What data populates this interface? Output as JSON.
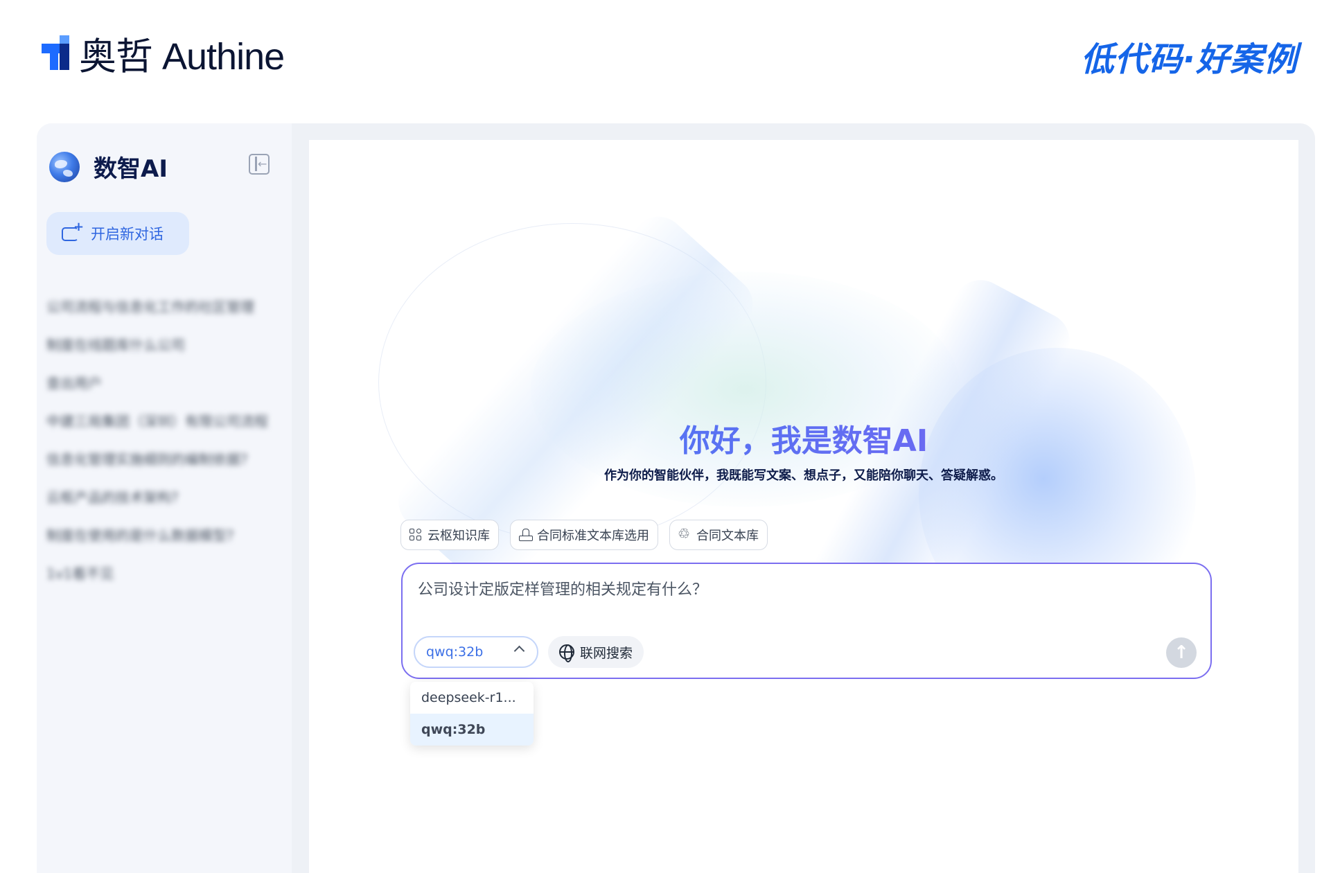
{
  "header": {
    "brand_name": "奥哲 Authine",
    "slogan": "低代码·好案例"
  },
  "sidebar": {
    "title": "数智AI",
    "new_chat_label": "开启新对话",
    "history": [
      "公司流程与信息化工作的社区管理",
      "制度在线题库什么公司",
      "查出用户",
      "中建三局集团（深圳）有限公司流程",
      "信息化管理实施细则的编制依据?",
      "云枢产品的技术架构?",
      "制度在使用的是什么数据模型?",
      "1v1看不见"
    ]
  },
  "main": {
    "greeting": "你好，我是数智AI",
    "subtitle": "作为你的智能伙伴，我既能写文案、想点子，又能陪你聊天、答疑解惑。",
    "chips": [
      {
        "label": "云枢知识库",
        "icon": "grid-icon"
      },
      {
        "label": "合同标准文本库选用",
        "icon": "stamp-icon"
      },
      {
        "label": "合同文本库",
        "icon": "recycle-icon"
      }
    ],
    "input": {
      "value": "公司设计定版定样管理的相关规定有什么？",
      "placeholder": ""
    },
    "model": {
      "selected": "qwq:32b",
      "options": [
        "deepseek-r1...",
        "qwq:32b"
      ]
    },
    "web_search_label": "联网搜索",
    "colors": {
      "accent": "#2f66e0",
      "input_border": "#7b6ef0",
      "greeting_gradient": [
        "#3d7ef5",
        "#8a5cf0"
      ]
    }
  }
}
